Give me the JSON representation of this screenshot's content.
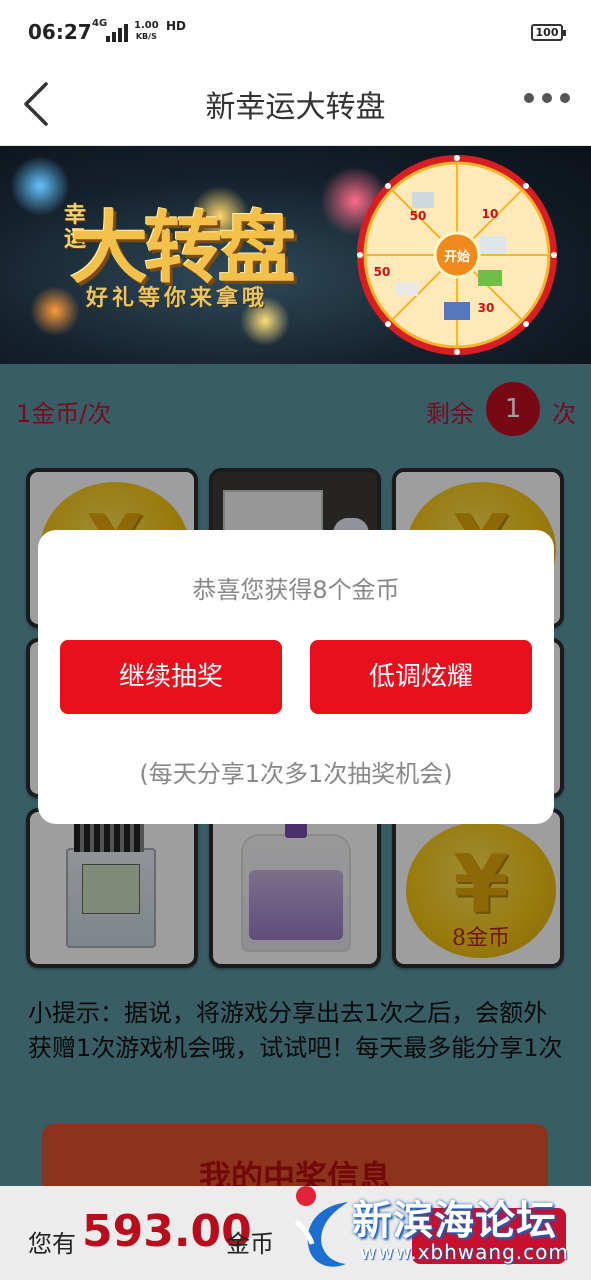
{
  "status": {
    "time": "06:27",
    "network": "4G",
    "speed_value": "1.00",
    "speed_unit": "KB/S",
    "hd": "HD",
    "battery": "100"
  },
  "nav": {
    "title": "新幸运大转盘",
    "back_icon": "chevron-left-icon",
    "more_icon": "more-dots-icon"
  },
  "banner": {
    "luck_text": "幸运",
    "main_text": "大转盘",
    "subtitle": "好礼等你来拿哦",
    "wheel_center": "开始",
    "wheel_labels": [
      "50",
      "10",
      "30",
      "50"
    ]
  },
  "counter": {
    "price": "1金币/次",
    "remaining_label": "剩余",
    "remaining_count": "1",
    "times_label": "次"
  },
  "grid": {
    "coin_label": "8金币",
    "yen_symbol": "¥"
  },
  "dialog": {
    "message": "恭喜您获得8个金币",
    "continue_label": "继续抽奖",
    "share_label": "低调炫耀",
    "note": "(每天分享1次多1次抽奖机会)"
  },
  "tip": {
    "text": "小提示：据说，将游戏分享出去1次之后，会额外获赠1次游戏机会哦，试试吧！每天最多能分享1次"
  },
  "prize_button": {
    "label": "我的中奖信息"
  },
  "bottom": {
    "you_have": "您有",
    "amount": "593.00",
    "unit": "金币"
  },
  "watermark": {
    "title": "新滨海论坛",
    "url": "www.xbhwang.com"
  },
  "colors": {
    "accent": "#e8101d",
    "page_bg": "#5b96a4",
    "coin": "#f7c817"
  }
}
